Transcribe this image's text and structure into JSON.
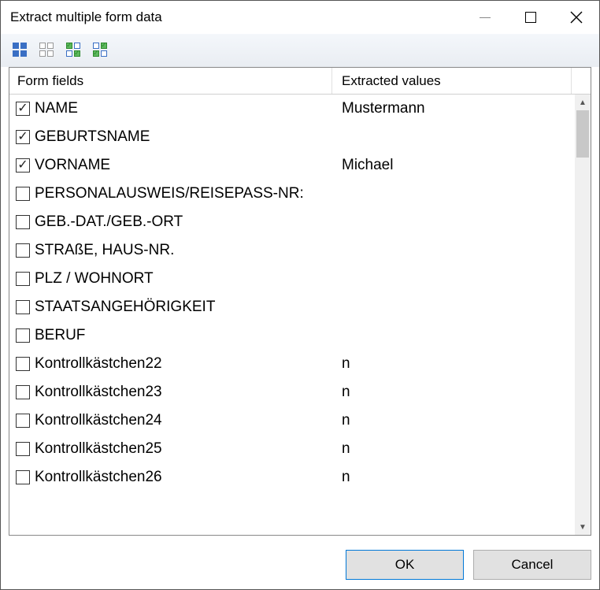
{
  "window": {
    "title": "Extract multiple form data"
  },
  "columns": {
    "fields": "Form fields",
    "values": "Extracted values"
  },
  "rows": [
    {
      "checked": true,
      "field": "NAME",
      "value": "Mustermann"
    },
    {
      "checked": true,
      "field": "GEBURTSNAME",
      "value": ""
    },
    {
      "checked": true,
      "field": "VORNAME",
      "value": "Michael"
    },
    {
      "checked": false,
      "field": "PERSONALAUSWEIS/REISEPASS-NR:",
      "value": ""
    },
    {
      "checked": false,
      "field": "GEB.-DAT./GEB.-ORT",
      "value": ""
    },
    {
      "checked": false,
      "field": "STRAßE, HAUS-NR.",
      "value": ""
    },
    {
      "checked": false,
      "field": "PLZ / WOHNORT",
      "value": ""
    },
    {
      "checked": false,
      "field": "STAATSANGEHÖRIGKEIT",
      "value": ""
    },
    {
      "checked": false,
      "field": "BERUF",
      "value": ""
    },
    {
      "checked": false,
      "field": "Kontrollkästchen22",
      "value": "n"
    },
    {
      "checked": false,
      "field": "Kontrollkästchen23",
      "value": "n"
    },
    {
      "checked": false,
      "field": "Kontrollkästchen24",
      "value": "n"
    },
    {
      "checked": false,
      "field": "Kontrollkästchen25",
      "value": "n"
    },
    {
      "checked": false,
      "field": "Kontrollkästchen26",
      "value": "n"
    }
  ],
  "buttons": {
    "ok": "OK",
    "cancel": "Cancel"
  },
  "toolbar_icons": {
    "select_all": "select-all-icon",
    "select_none": "select-none-icon",
    "toggle_1": "toggle-selection-icon",
    "toggle_2": "invert-selection-icon"
  }
}
